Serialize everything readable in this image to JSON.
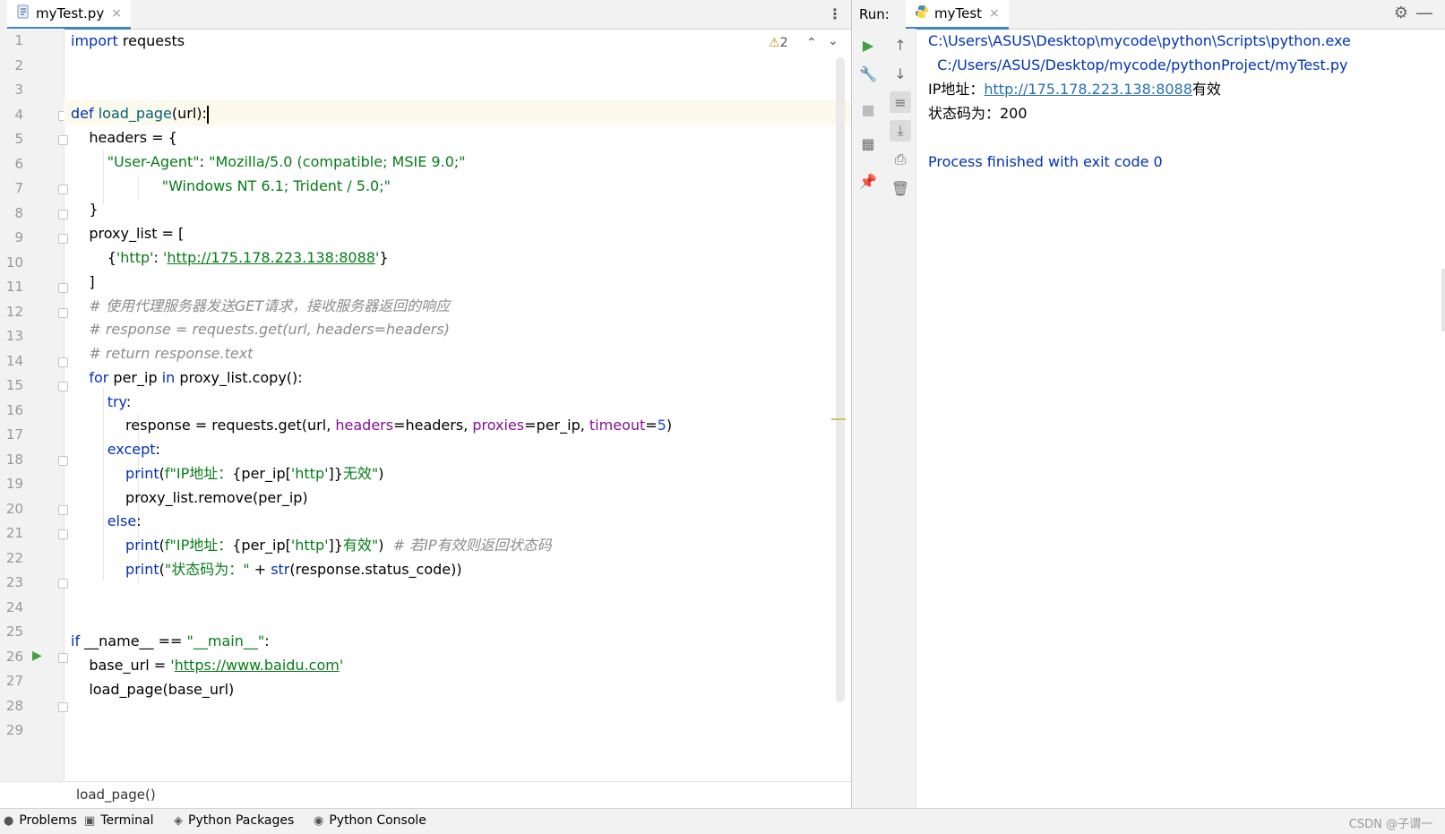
{
  "editor": {
    "tab": {
      "label": "myTest.py",
      "icon": "python-file-icon",
      "close": "×"
    },
    "menu": "⋮",
    "inspection": {
      "warnings": "2"
    },
    "line_numbers": [
      "1",
      "2",
      "3",
      "4",
      "5",
      "6",
      "7",
      "8",
      "9",
      "10",
      "11",
      "12",
      "13",
      "14",
      "15",
      "16",
      "17",
      "18",
      "19",
      "20",
      "21",
      "22",
      "23",
      "24",
      "25",
      "26",
      "27",
      "28",
      "29"
    ],
    "breadcrumb": "load_page()"
  },
  "code": {
    "l1a": "import",
    "l1b": " requests",
    "l4a": "def ",
    "l4b": "load_page",
    "l4c": "(url):",
    "l5": "    headers = {",
    "l6a": "        ",
    "l6b": "\"User-Agent\"",
    "l6c": ": ",
    "l6d": "\"Mozilla/5.0 (compatible; MSIE 9.0;\"",
    "l7a": "                    ",
    "l7b": "\"Windows NT 6.1; Trident / 5.0;\"",
    "l8": "    }",
    "l9": "    proxy_list = [",
    "l10a": "        {",
    "l10b": "'http'",
    "l10c": ": ",
    "l10d": "'",
    "l10e": "http://175.178.223.138:8088",
    "l10f": "'",
    "l10g": "}",
    "l11": "    ]",
    "l12": "    # 使用代理服务器发送GET请求，接收服务器返回的响应",
    "l13": "    # response = requests.get(url, headers=headers)",
    "l14": "    # return response.text",
    "l15a": "    ",
    "l15b": "for",
    "l15c": " per_ip ",
    "l15d": "in",
    "l15e": " proxy_list.copy():",
    "l16a": "        ",
    "l16b": "try",
    "l16c": ":",
    "l17a": "            response = requests.get(url, ",
    "l17b": "headers",
    "l17c": "=headers, ",
    "l17d": "proxies",
    "l17e": "=per_ip, ",
    "l17f": "timeout",
    "l17g": "=",
    "l17h": "5",
    "l17i": ")",
    "l18a": "        ",
    "l18b": "except",
    "l18c": ":",
    "l19a": "            ",
    "l19b": "print",
    "l19c": "(",
    "l19d": "f\"IP地址：",
    "l19e": "{per_ip[",
    "l19f": "'http'",
    "l19g": "]}",
    "l19h": "无效\"",
    "l19i": ")",
    "l20": "            proxy_list.remove(per_ip)",
    "l21a": "        ",
    "l21b": "else",
    "l21c": ":",
    "l22a": "            ",
    "l22b": "print",
    "l22c": "(",
    "l22d": "f\"IP地址：",
    "l22e": "{per_ip[",
    "l22f": "'http'",
    "l22g": "]}",
    "l22h": "有效\"",
    "l22i": ")  ",
    "l22j": "# 若IP有效则返回状态码",
    "l23a": "            ",
    "l23b": "print",
    "l23c": "(",
    "l23d": "\"状态码为：\"",
    "l23e": " + ",
    "l23f": "str",
    "l23g": "(response.status_code))",
    "l26a": "if",
    "l26b": " __name__ == ",
    "l26c": "\"__main__\"",
    "l26d": ":",
    "l27a": "    base_url = ",
    "l27b": "'",
    "l27c": "https://www.baidu.com",
    "l27d": "'",
    "l28": "    load_page(base_url)"
  },
  "run": {
    "label": "Run:",
    "tab": {
      "label": "myTest",
      "icon": "python-icon",
      "close": "×"
    },
    "output": {
      "cmd1": "C:\\Users\\ASUS\\Desktop\\mycode\\python\\Scripts\\python.exe",
      "cmd2": "  C:/Users/ASUS/Desktop/mycode/pythonProject/myTest.py",
      "ip_prefix": "IP地址：",
      "ip_link": "http://175.178.223.138:8088",
      "ip_suffix": "有效",
      "status": "状态码为：200",
      "finished": "Process finished with exit code 0"
    }
  },
  "statusbar": {
    "items": [
      {
        "label": "Problems",
        "icon": "problems-icon"
      },
      {
        "label": "Terminal",
        "icon": "terminal-icon"
      },
      {
        "label": "Python Packages",
        "icon": "packages-icon"
      },
      {
        "label": "Python Console",
        "icon": "python-console-icon"
      }
    ],
    "watermark": "CSDN @子谓一"
  },
  "colors": {
    "keyword": "#0033b3",
    "string": "#067d17",
    "comment": "#8c8c8c",
    "param": "#871094",
    "tab_underline": "#4083c9",
    "run_green": "#40a040"
  }
}
